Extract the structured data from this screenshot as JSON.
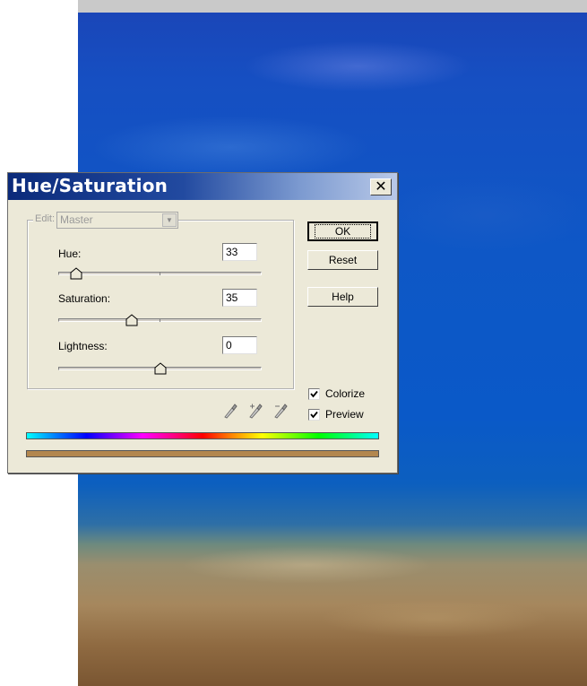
{
  "window": {
    "title": "Hue/Saturation"
  },
  "edit": {
    "label": "Edit:",
    "selected": "Master"
  },
  "adjustments": {
    "hue": {
      "label": "Hue:",
      "value": "33",
      "position": 0.09
    },
    "saturation": {
      "label": "Saturation:",
      "value": "35",
      "position": 0.36
    },
    "lightness": {
      "label": "Lightness:",
      "value": "0",
      "position": 0.5
    }
  },
  "buttons": {
    "ok": "OK",
    "reset": "Reset",
    "help": "Help"
  },
  "options": {
    "colorize": {
      "label": "Colorize",
      "checked": true
    },
    "preview": {
      "label": "Preview",
      "checked": true
    }
  },
  "colors": {
    "result_bar": "#b3874e",
    "title_start": "#0b2a7a",
    "title_end": "#b9c9e8"
  },
  "icons": [
    "eyedropper-icon",
    "eyedropper-plus-icon",
    "eyedropper-minus-icon"
  ]
}
